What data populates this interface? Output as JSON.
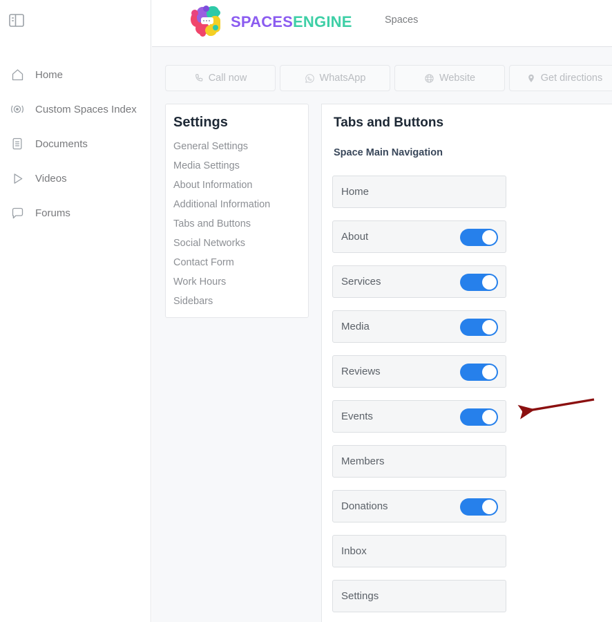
{
  "sidebar": {
    "collapse_icon": "sidebar-toggle-icon",
    "items": [
      {
        "label": "Home",
        "icon": "home-icon"
      },
      {
        "label": "Custom Spaces Index",
        "icon": "broadcast-icon"
      },
      {
        "label": "Documents",
        "icon": "document-icon"
      },
      {
        "label": "Videos",
        "icon": "play-icon"
      },
      {
        "label": "Forums",
        "icon": "chat-bubble-icon"
      }
    ]
  },
  "header": {
    "logo_text_1": "SPACES",
    "logo_text_2": "ENGINE",
    "logo_color_1": "#8b5cf0",
    "logo_color_2": "#3ecfa6",
    "nav_link": "Spaces"
  },
  "actionbar": {
    "buttons": [
      {
        "label": "Call now",
        "icon": "phone-icon"
      },
      {
        "label": "WhatsApp",
        "icon": "whatsapp-icon"
      },
      {
        "label": "Website",
        "icon": "globe-icon"
      },
      {
        "label": "Get directions",
        "icon": "map-pin-icon"
      }
    ]
  },
  "settings_card": {
    "title": "Settings",
    "links": [
      "General Settings",
      "Media Settings",
      "About Information",
      "Additional Information",
      "Tabs and Buttons",
      "Social Networks",
      "Contact Form",
      "Work Hours",
      "Sidebars"
    ]
  },
  "main_panel": {
    "title": "Tabs and Buttons",
    "subtitle": "Space Main Navigation",
    "rows": [
      {
        "label": "Home",
        "has_toggle": false,
        "toggle_on": false
      },
      {
        "label": "About",
        "has_toggle": true,
        "toggle_on": true
      },
      {
        "label": "Services",
        "has_toggle": true,
        "toggle_on": true
      },
      {
        "label": "Media",
        "has_toggle": true,
        "toggle_on": true
      },
      {
        "label": "Reviews",
        "has_toggle": true,
        "toggle_on": true
      },
      {
        "label": "Events",
        "has_toggle": true,
        "toggle_on": true
      },
      {
        "label": "Members",
        "has_toggle": false,
        "toggle_on": false
      },
      {
        "label": "Donations",
        "has_toggle": true,
        "toggle_on": true
      },
      {
        "label": "Inbox",
        "has_toggle": false,
        "toggle_on": false
      },
      {
        "label": "Settings",
        "has_toggle": false,
        "toggle_on": false
      }
    ]
  },
  "annotation": {
    "arrow_color": "#8b1010",
    "points_at": "Events"
  },
  "colors": {
    "toggle_on": "#2680eb",
    "content_bg": "#f7f8fa",
    "row_bg": "#f5f6f7"
  }
}
